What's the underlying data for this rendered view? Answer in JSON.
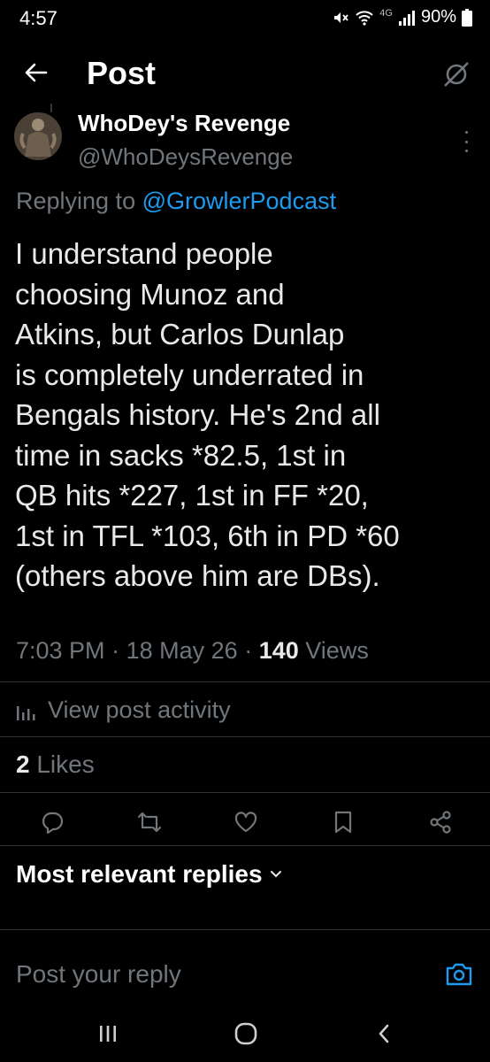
{
  "status_bar": {
    "time": "4:57",
    "network": "4G",
    "battery": "90%"
  },
  "header": {
    "title": "Post",
    "back_icon": "arrow-left-icon",
    "right_icon": "no-grok-icon"
  },
  "post": {
    "author_name": "WhoDey's Revenge",
    "author_handle": "@WhoDeysRevenge",
    "replying_prefix": "Replying to",
    "replying_to": "@GrowlerPodcast",
    "text": "I understand people\nchoosing Munoz and\nAtkins, but Carlos Dunlap\nis completely underrated in\nBengals history. He's 2nd all\ntime in sacks *82.5, 1st in\nQB hits *227, 1st in FF *20,\n1st in TFL *103, 6th in PD *60\n(others above him are DBs).",
    "time": "7:03 PM",
    "date": "18 May 26",
    "separator": "·",
    "views_count": "140",
    "views_label": "Views"
  },
  "activity": {
    "label": "View post activity"
  },
  "likes": {
    "count": "2",
    "label": "Likes"
  },
  "actions": [
    "reply-icon",
    "repost-icon",
    "like-icon",
    "bookmark-icon",
    "share-icon"
  ],
  "replies_sort": {
    "label": "Most relevant replies"
  },
  "reply_box": {
    "placeholder": "Post your reply"
  },
  "colors": {
    "background": "#000000",
    "text": "#e7e9ea",
    "secondary": "#71767b",
    "accent": "#1d9bf0"
  }
}
